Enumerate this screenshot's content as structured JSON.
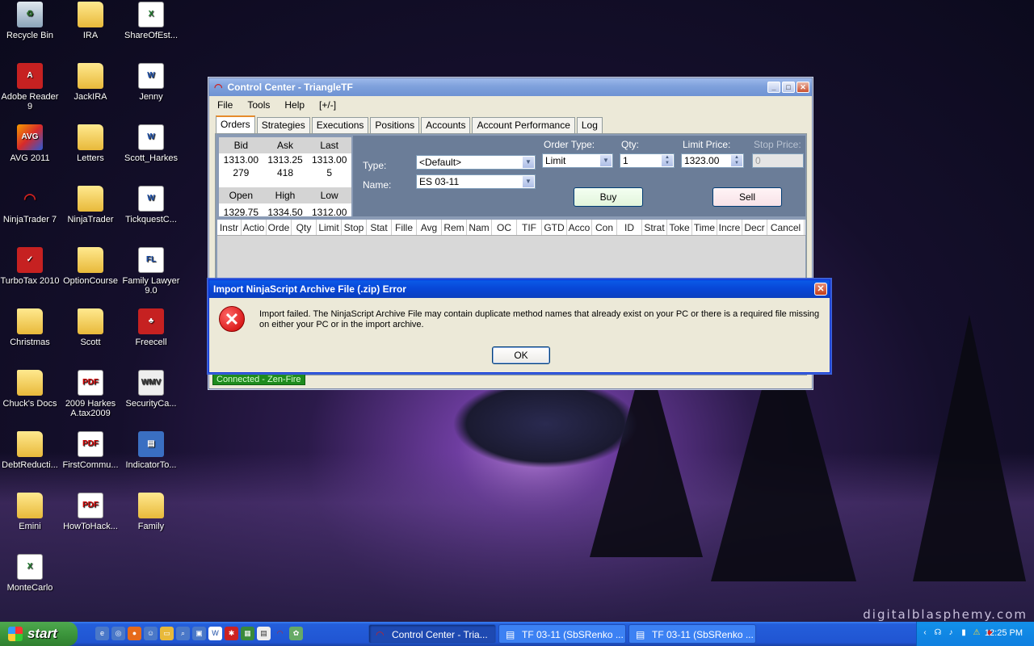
{
  "desktop": {
    "watermark": "digitalblasphemy.com",
    "icons": [
      {
        "label": "Recycle Bin",
        "icon": "recycle-bin-icon"
      },
      {
        "label": "IRA",
        "icon": "folder-icon"
      },
      {
        "label": "ShareOfEst...",
        "icon": "excel-file-icon"
      },
      {
        "label": "Adobe Reader 9",
        "icon": "adobe-reader-icon"
      },
      {
        "label": "JackIRA",
        "icon": "folder-icon"
      },
      {
        "label": "Jenny",
        "icon": "word-file-icon"
      },
      {
        "label": "AVG 2011",
        "icon": "avg-icon"
      },
      {
        "label": "Letters",
        "icon": "folder-icon"
      },
      {
        "label": "Scott_Harkes",
        "icon": "word-file-icon"
      },
      {
        "label": "NinjaTrader 7",
        "icon": "ninjatrader-icon"
      },
      {
        "label": "NinjaTrader",
        "icon": "folder-icon"
      },
      {
        "label": "TickquestC...",
        "icon": "word-file-icon"
      },
      {
        "label": "TurboTax 2010",
        "icon": "turbotax-icon"
      },
      {
        "label": "OptionCourse",
        "icon": "folder-icon"
      },
      {
        "label": "Family Lawyer 9.0",
        "icon": "family-lawyer-icon"
      },
      {
        "label": "Christmas",
        "icon": "folder-icon"
      },
      {
        "label": "Scott",
        "icon": "folder-icon"
      },
      {
        "label": "Freecell",
        "icon": "freecell-icon"
      },
      {
        "label": "Chuck's Docs",
        "icon": "folder-icon"
      },
      {
        "label": "2009 Harkes A.tax2009",
        "icon": "pdf-file-icon"
      },
      {
        "label": "SecurityCa...",
        "icon": "wmv-file-icon"
      },
      {
        "label": "DebtReducti...",
        "icon": "folder-icon"
      },
      {
        "label": "FirstCommu...",
        "icon": "pdf-file-icon"
      },
      {
        "label": "IndicatorTo...",
        "icon": "archive-file-icon"
      },
      {
        "label": "Emini",
        "icon": "folder-icon"
      },
      {
        "label": "HowToHack...",
        "icon": "pdf-file-icon"
      },
      {
        "label": "Family",
        "icon": "folder-icon"
      },
      {
        "label": "MonteCarlo",
        "icon": "excel-file-icon"
      }
    ]
  },
  "window": {
    "title": "Control Center - TriangleTF",
    "menu": [
      "File",
      "Tools",
      "Help",
      "[+/-]"
    ],
    "tabs": [
      "Orders",
      "Strategies",
      "Executions",
      "Positions",
      "Accounts",
      "Account Performance",
      "Log"
    ],
    "quote": {
      "headers": [
        "Bid",
        "Ask",
        "Last"
      ],
      "prices": [
        "1313.00",
        "1313.25",
        "1313.00"
      ],
      "sizes": [
        "279",
        "418",
        "5"
      ],
      "headers2": [
        "Open",
        "High",
        "Low"
      ],
      "values2": [
        "1329.75",
        "1334.50",
        "1312.00"
      ]
    },
    "order": {
      "type_label": "Type:",
      "type_value": "<Default>",
      "name_label": "Name:",
      "name_value": "ES 03-11",
      "order_type_label": "Order Type:",
      "order_type_value": "Limit",
      "qty_label": "Qty:",
      "qty_value": "1",
      "limit_label": "Limit Price:",
      "limit_value": "1323.00",
      "stop_label": "Stop Price:",
      "stop_value": "0",
      "buy": "Buy",
      "sell": "Sell"
    },
    "grid_columns": [
      "Instr",
      "Actio",
      "Orde",
      "Qty",
      "Limit",
      "Stop",
      "Stat",
      "Fille",
      "Avg",
      "Rem",
      "Nam",
      "OC",
      "TIF",
      "GTD",
      "Acco",
      "Con",
      "ID",
      "Strat",
      "Toke",
      "Time",
      "Incre",
      "Decr",
      "Cancel"
    ],
    "status": "Connected - Zen-Fire"
  },
  "dialog": {
    "title": "Import NinjaScript Archive File (.zip) Error",
    "message": "Import failed. The NinjaScript Archive File may contain duplicate method names that already exist on your PC or there is a required file missing on either your PC or in the import archive.",
    "ok": "OK"
  },
  "taskbar": {
    "start": "start",
    "tasks": [
      "Control Center - Tria...",
      "TF 03-11 (SbSRenko ...",
      "TF 03-11 (SbSRenko ..."
    ],
    "clock": "12:25 PM"
  }
}
